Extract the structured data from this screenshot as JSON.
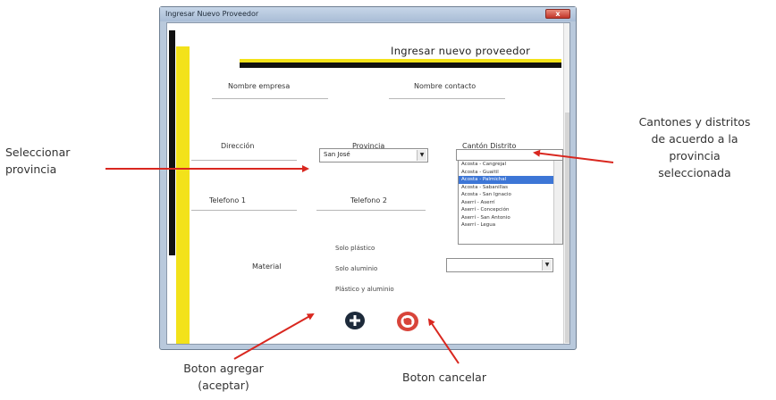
{
  "window": {
    "title": "Ingresar Nuevo Proveedor",
    "close_glyph": "x"
  },
  "form": {
    "title": "Ingresar nuevo proveedor",
    "labels": {
      "company_name": "Nombre empresa",
      "contact_name": "Nombre contacto",
      "address": "Dirección",
      "province": "Provincia",
      "canton_district": "Cantón Distrito",
      "phone1": "Telefono 1",
      "phone2": "Telefono 2",
      "material": "Material"
    },
    "province_value": "San José",
    "canton_list": [
      "Acosta - Cangrejal",
      "Acosta - Guaitil",
      "Acosta - Palmichal",
      "Acosta - Sabanillas",
      "Acosta - San Ignacio",
      "Aserrí - Aserrí",
      "Aserrí - Concepción",
      "Aserrí - San Antonio",
      "Aserrí - Legua"
    ],
    "canton_selected_index": 2,
    "material_options": [
      "Solo plástico",
      "Solo aluminio",
      "Plástico y aluminio"
    ]
  },
  "annotations": {
    "select_province": [
      "Seleccionar",
      "provincia"
    ],
    "cantons": [
      "Cantones y distritos",
      "de acuerdo a la",
      "provincia",
      "seleccionada"
    ],
    "add_button": [
      "Boton agregar",
      "(aceptar)"
    ],
    "cancel_button": "Boton cancelar"
  },
  "colors": {
    "accent_yellow": "#f3e21a",
    "arrow_red": "#d9271f",
    "selection_blue": "#3d76d6"
  },
  "icons": {
    "add": "plus-circle-icon",
    "cancel": "cancel-circle-icon"
  }
}
